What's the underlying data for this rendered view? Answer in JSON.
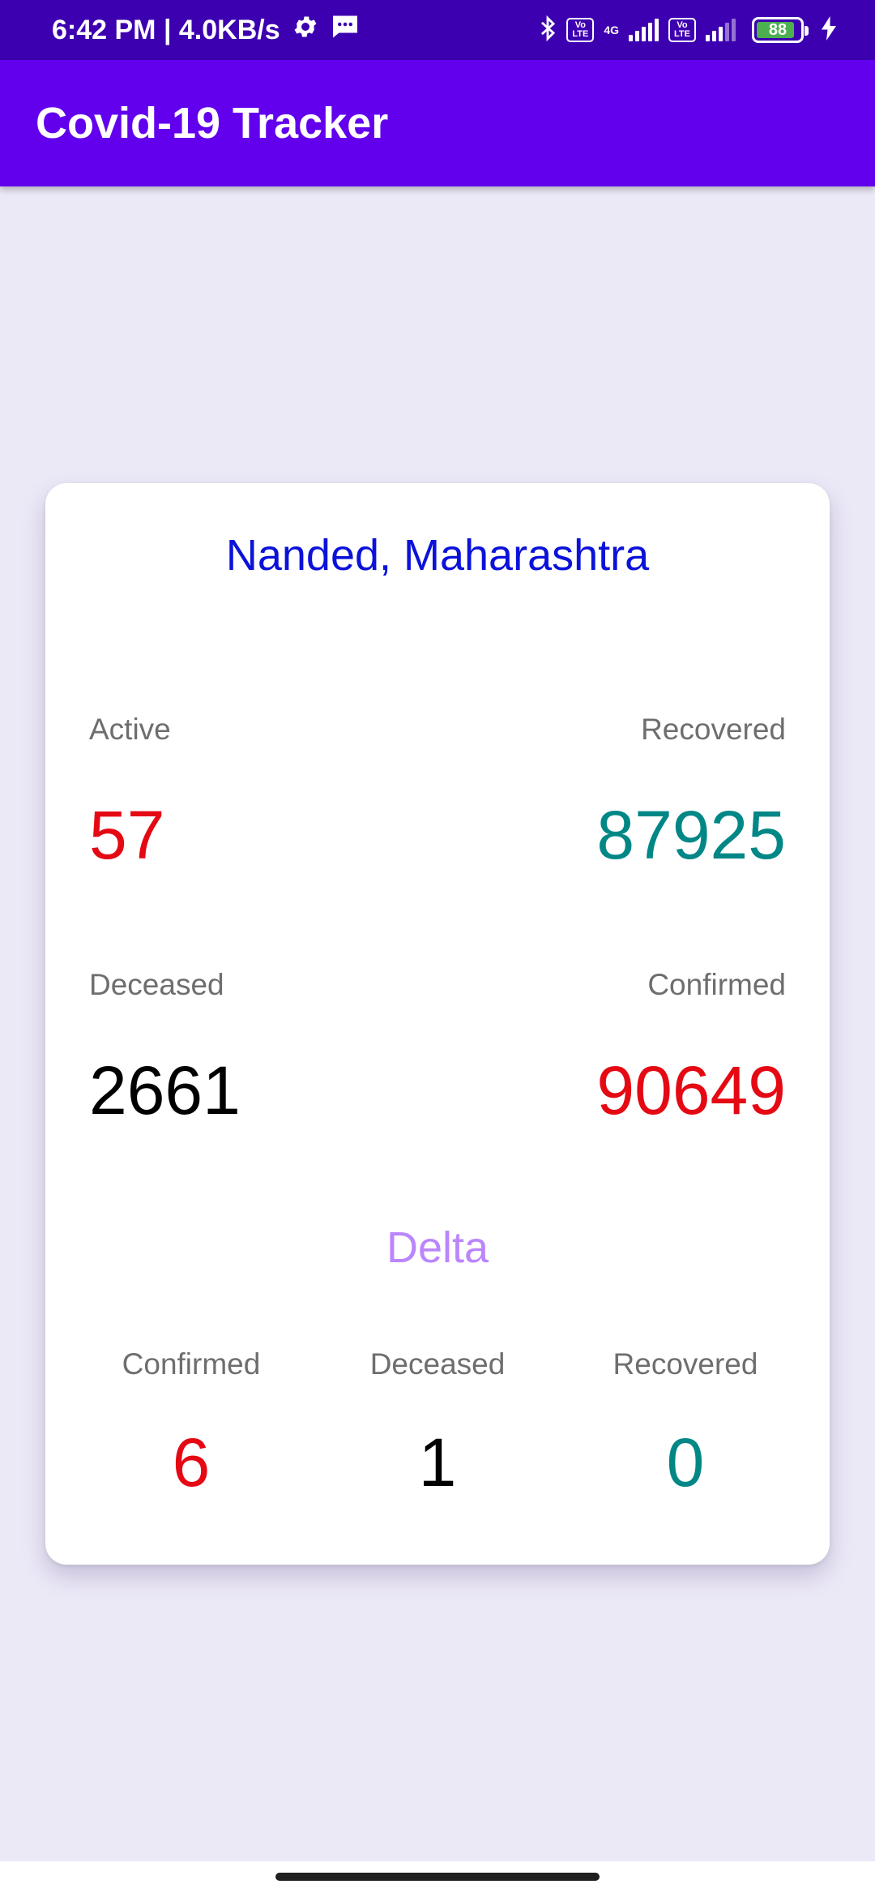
{
  "status_bar": {
    "time_speed": "6:42 PM | 4.0KB/s",
    "icons": [
      "gear-icon",
      "message-icon",
      "bluetooth-icon",
      "volte-icon",
      "signal-icon",
      "battery-icon",
      "charging-icon"
    ],
    "volte_label": "Vo LTE",
    "network_type": "4G",
    "battery_level": "88"
  },
  "app_bar": {
    "title": "Covid-19 Tracker",
    "color": "#6200EE"
  },
  "card": {
    "location": "Nanded, Maharashtra",
    "stats": {
      "active": {
        "label": "Active",
        "value": "57"
      },
      "recovered": {
        "label": "Recovered",
        "value": "87925"
      },
      "deceased": {
        "label": "Deceased",
        "value": "2661"
      },
      "confirmed": {
        "label": "Confirmed",
        "value": "90649"
      }
    },
    "delta": {
      "title": "Delta",
      "confirmed": {
        "label": "Confirmed",
        "value": "6"
      },
      "deceased": {
        "label": "Deceased",
        "value": "1"
      },
      "recovered": {
        "label": "Recovered",
        "value": "0"
      }
    }
  },
  "colors": {
    "status_bar": "#3D00B0",
    "background": "#ECE9F7",
    "location_text": "#0B12D9",
    "delta_title": "#BB86FC",
    "red": "#E50914",
    "teal": "#018786"
  }
}
